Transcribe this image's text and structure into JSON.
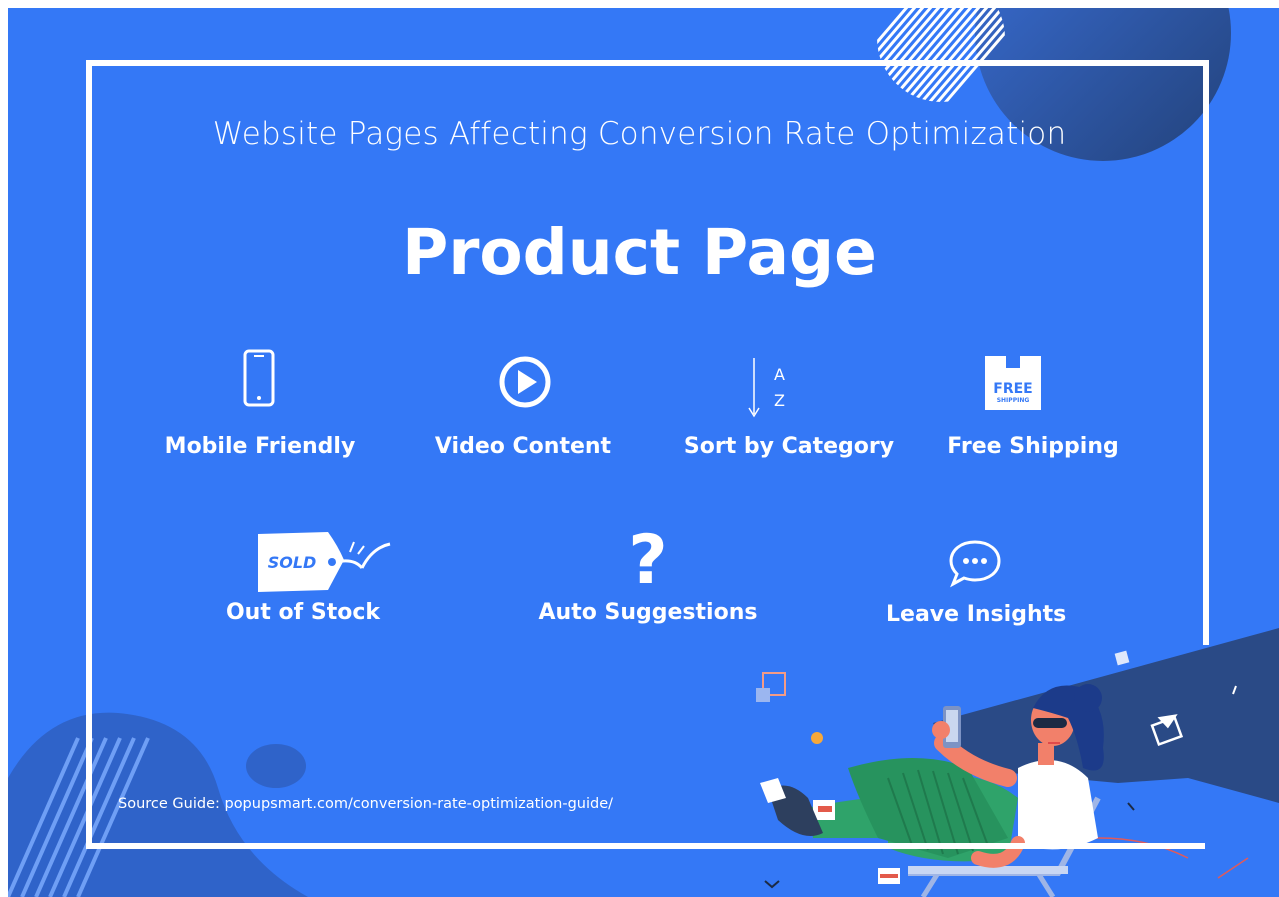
{
  "header": {
    "subtitle": "Website Pages Affecting  Conversion Rate Optimization",
    "title": "Product Page"
  },
  "features_row1": [
    {
      "label": "Mobile Friendly",
      "icon": "mobile-phone-icon"
    },
    {
      "label": "Video Content",
      "icon": "play-circle-icon"
    },
    {
      "label": "Sort by Category",
      "icon": "sort-az-icon",
      "icon_letters": [
        "A",
        "Z"
      ]
    },
    {
      "label": "Free Shipping",
      "icon": "free-shipping-box-icon",
      "icon_text": [
        "FREE",
        "SHIPPING"
      ]
    }
  ],
  "features_row2": [
    {
      "label": "Out of Stock",
      "icon": "sold-tag-icon",
      "icon_text": "SOLD"
    },
    {
      "label": "Auto Suggestions",
      "icon": "question-mark-icon",
      "glyph": "?"
    },
    {
      "label": "Leave Insights",
      "icon": "chat-bubble-icon"
    }
  ],
  "footer": {
    "source": "Source Guide: popupsmart.com/conversion-rate-optimization-guide/"
  },
  "colors": {
    "background": "#3478f6",
    "frame": "#ffffff",
    "dark_shape": "#2d5fb8",
    "shadow": "#2a4a86"
  }
}
